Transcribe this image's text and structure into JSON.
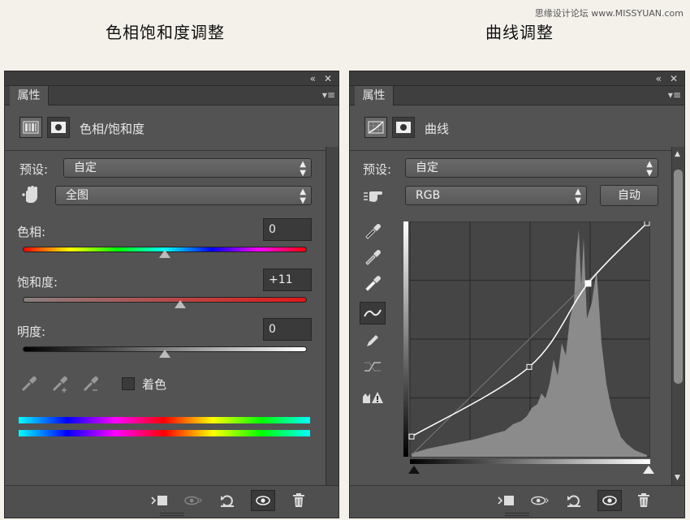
{
  "headings": {
    "left": "色相饱和度调整",
    "right": "曲线调整"
  },
  "watermark": "思缘设计论坛 www.MISSYUAN.com",
  "hue_panel": {
    "tab": "属性",
    "title": "色相/饱和度",
    "preset_label": "预设:",
    "preset_value": "自定",
    "channel_value": "全图",
    "hue_label": "色相:",
    "hue_value": "0",
    "hue_level": 0,
    "saturation_label": "饱和度:",
    "saturation_value": "+11",
    "saturation_level": 11,
    "lightness_label": "明度:",
    "lightness_value": "0",
    "lightness_level": 0,
    "colorize_label": "着色"
  },
  "curves_panel": {
    "tab": "属性",
    "title": "曲线",
    "preset_label": "预设:",
    "preset_value": "自定",
    "channel_value": "RGB",
    "auto_label": "自动",
    "curve_points": [
      [
        0,
        0.08
      ],
      [
        0.5,
        0.38
      ],
      [
        0.75,
        0.74
      ],
      [
        1,
        1
      ]
    ]
  },
  "icons": {
    "collapse": "«",
    "close": "✕",
    "menu": "▾≡"
  },
  "colors": {
    "panel": "#535353",
    "background": "#f4f1ea"
  }
}
